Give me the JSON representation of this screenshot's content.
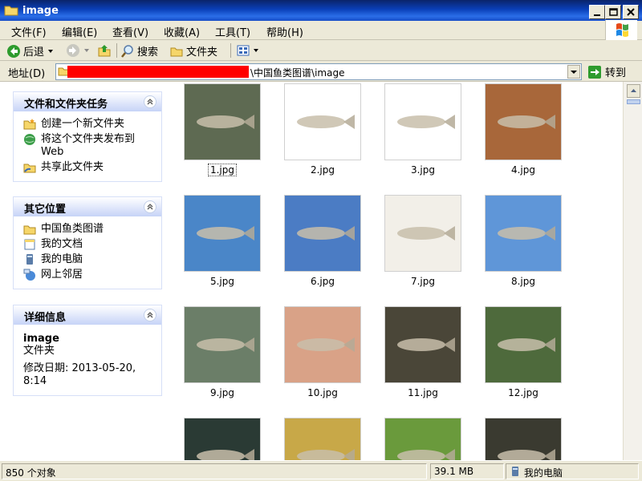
{
  "window": {
    "title": "image"
  },
  "menu": [
    "文件(F)",
    "编辑(E)",
    "查看(V)",
    "收藏(A)",
    "工具(T)",
    "帮助(H)"
  ],
  "toolbar": {
    "back": "后退",
    "search": "搜索",
    "folders": "文件夹"
  },
  "address": {
    "label": "地址(D)",
    "path": "\\中国鱼类图谱\\image",
    "go": "转到"
  },
  "tasks": {
    "title": "文件和文件夹任务",
    "items": [
      "创建一个新文件夹",
      "将这个文件夹发布到 Web",
      "共享此文件夹"
    ]
  },
  "places": {
    "title": "其它位置",
    "items": [
      "中国鱼类图谱",
      "我的文档",
      "我的电脑",
      "网上邻居"
    ]
  },
  "details": {
    "title": "详细信息",
    "name": "image",
    "type": "文件夹",
    "modified": "修改日期: 2013-05-20, 8:14"
  },
  "files": [
    {
      "name": "1.jpg",
      "bg": "#5e6a52"
    },
    {
      "name": "2.jpg",
      "bg": "#ffffff"
    },
    {
      "name": "3.jpg",
      "bg": "#ffffff"
    },
    {
      "name": "4.jpg",
      "bg": "#a8673a"
    },
    {
      "name": "5.jpg",
      "bg": "#4a86c8"
    },
    {
      "name": "6.jpg",
      "bg": "#4b7cc4"
    },
    {
      "name": "7.jpg",
      "bg": "#f2efe8"
    },
    {
      "name": "8.jpg",
      "bg": "#5f96d8"
    },
    {
      "name": "9.jpg",
      "bg": "#6b7e68"
    },
    {
      "name": "10.jpg",
      "bg": "#d9a287"
    },
    {
      "name": "11.jpg",
      "bg": "#4a4638"
    },
    {
      "name": "12.jpg",
      "bg": "#4e6a3c"
    },
    {
      "name": "",
      "bg": "#2a3a34"
    },
    {
      "name": "",
      "bg": "#c8a848"
    },
    {
      "name": "",
      "bg": "#6a9a3c"
    },
    {
      "name": "",
      "bg": "#3a3a30"
    }
  ],
  "status": {
    "count": "850 个对象",
    "size": "39.1 MB",
    "location": "我的电脑"
  }
}
